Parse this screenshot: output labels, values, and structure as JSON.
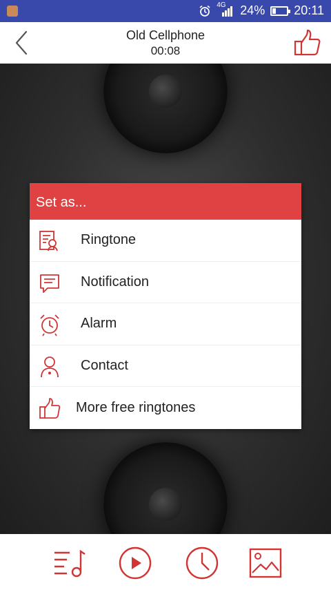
{
  "status_bar": {
    "network": "4G",
    "battery_percent": "24%",
    "battery_level": 0.24,
    "time": "20:11",
    "icons": [
      "app-notification-icon",
      "alarm-clock-icon",
      "signal-icon",
      "battery-icon"
    ]
  },
  "header": {
    "title": "Old Cellphone",
    "duration": "00:08",
    "back_icon": "back-arrow-icon",
    "like_icon": "thumbs-up-icon"
  },
  "dialog": {
    "title": "Set as...",
    "items": [
      {
        "label": "Ringtone",
        "icon": "ringtone-icon"
      },
      {
        "label": "Notification",
        "icon": "notification-icon"
      },
      {
        "label": "Alarm",
        "icon": "alarm-icon"
      },
      {
        "label": "Contact",
        "icon": "contact-icon"
      },
      {
        "label": "More free ringtones",
        "icon": "thumbs-up-icon"
      }
    ]
  },
  "bottom_bar": {
    "buttons": [
      "playlist-icon",
      "play-icon",
      "clock-icon",
      "image-icon"
    ]
  },
  "colors": {
    "accent": "#e04243",
    "status_bar": "#3949ab",
    "icon_red": "#d23434"
  }
}
